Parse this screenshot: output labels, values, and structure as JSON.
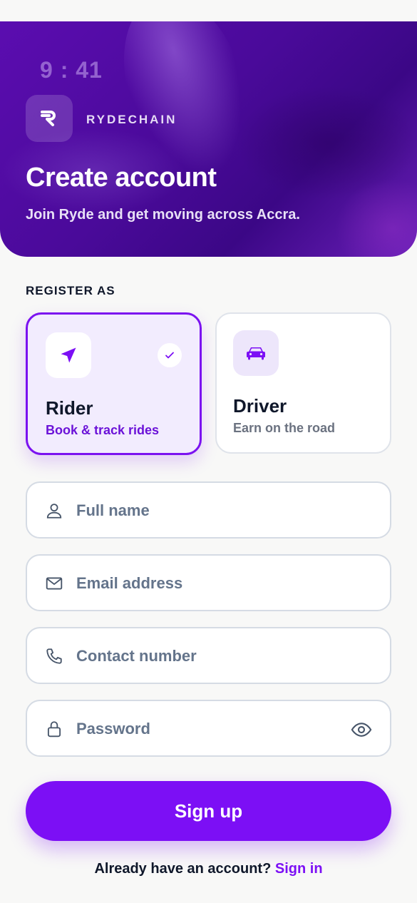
{
  "status_bar": {
    "time": "9 : 41"
  },
  "header": {
    "brand": "RYDECHAIN",
    "logo_icon": "ryde-logo-icon",
    "title": "Create account",
    "subtitle": "Join Ryde and get moving across Accra."
  },
  "register": {
    "label": "REGISTER AS",
    "roles": [
      {
        "title": "Rider",
        "subtitle": "Book & track rides",
        "icon": "navigation-arrow-icon",
        "selected": true
      },
      {
        "title": "Driver",
        "subtitle": "Earn on the road",
        "icon": "car-icon",
        "selected": false
      }
    ]
  },
  "form": {
    "full_name": {
      "placeholder": "Full name",
      "value": "",
      "icon": "user-icon"
    },
    "email": {
      "placeholder": "Email address",
      "value": "",
      "icon": "mail-icon"
    },
    "contact": {
      "placeholder": "Contact number",
      "value": "",
      "icon": "phone-icon"
    },
    "password": {
      "placeholder": "Password",
      "value": "",
      "icon": "lock-icon",
      "toggle_icon": "eye-icon"
    }
  },
  "actions": {
    "signup_label": "Sign up"
  },
  "footer": {
    "prompt": "Already have an account?",
    "link": "Sign in"
  },
  "colors": {
    "accent": "#7c0ff5",
    "hero": "#4a0a9a",
    "selected_bg": "#f2ecfe"
  }
}
